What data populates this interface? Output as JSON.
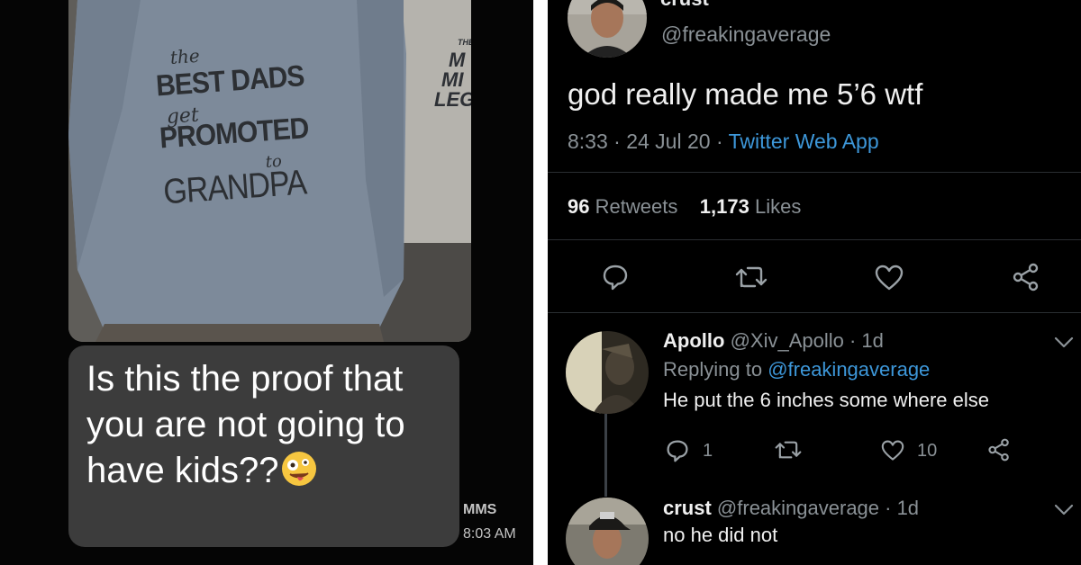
{
  "sms": {
    "shirt": {
      "line1": "the",
      "line2": "BEST DADS",
      "line3": "get",
      "line4": "PROMOTED",
      "line5": "to",
      "line6": "GRANDPA",
      "back_shirt_fragments": [
        "THE",
        "M",
        "MI",
        "LEG"
      ]
    },
    "message": "Is this the proof that you are not going to have kids??",
    "emoji_icon": "zany-face-emoji",
    "type_label": "MMS",
    "time": "8:03 AM"
  },
  "tweet": {
    "author_name": "crust",
    "author_handle": "@freakingaverage",
    "text": "god really made me 5’6 wtf",
    "timestamp": "8:33 · 24 Jul 20 · ",
    "source": "Twitter Web App",
    "retweets_count": "96",
    "retweets_label": "Retweets",
    "likes_count": "1,173",
    "likes_label": "Likes",
    "actions": [
      "comment-icon",
      "retweet-icon",
      "heart-icon",
      "share-icon"
    ]
  },
  "replies": [
    {
      "name": "Apollo",
      "handle": "@Xiv_Apollo · 1d",
      "replying_prefix": "Replying to ",
      "replying_to": "@freakingaverage",
      "text": "He put the 6 inches some where else",
      "reply_count": "1",
      "like_count": "10"
    },
    {
      "name": "crust",
      "handle": "@freakingaverage · 1d",
      "text": "no he did not"
    }
  ],
  "colors": {
    "link_blue": "#3d97d9",
    "muted_gray": "#8a9196",
    "bubble_gray": "#3c3c3c"
  }
}
